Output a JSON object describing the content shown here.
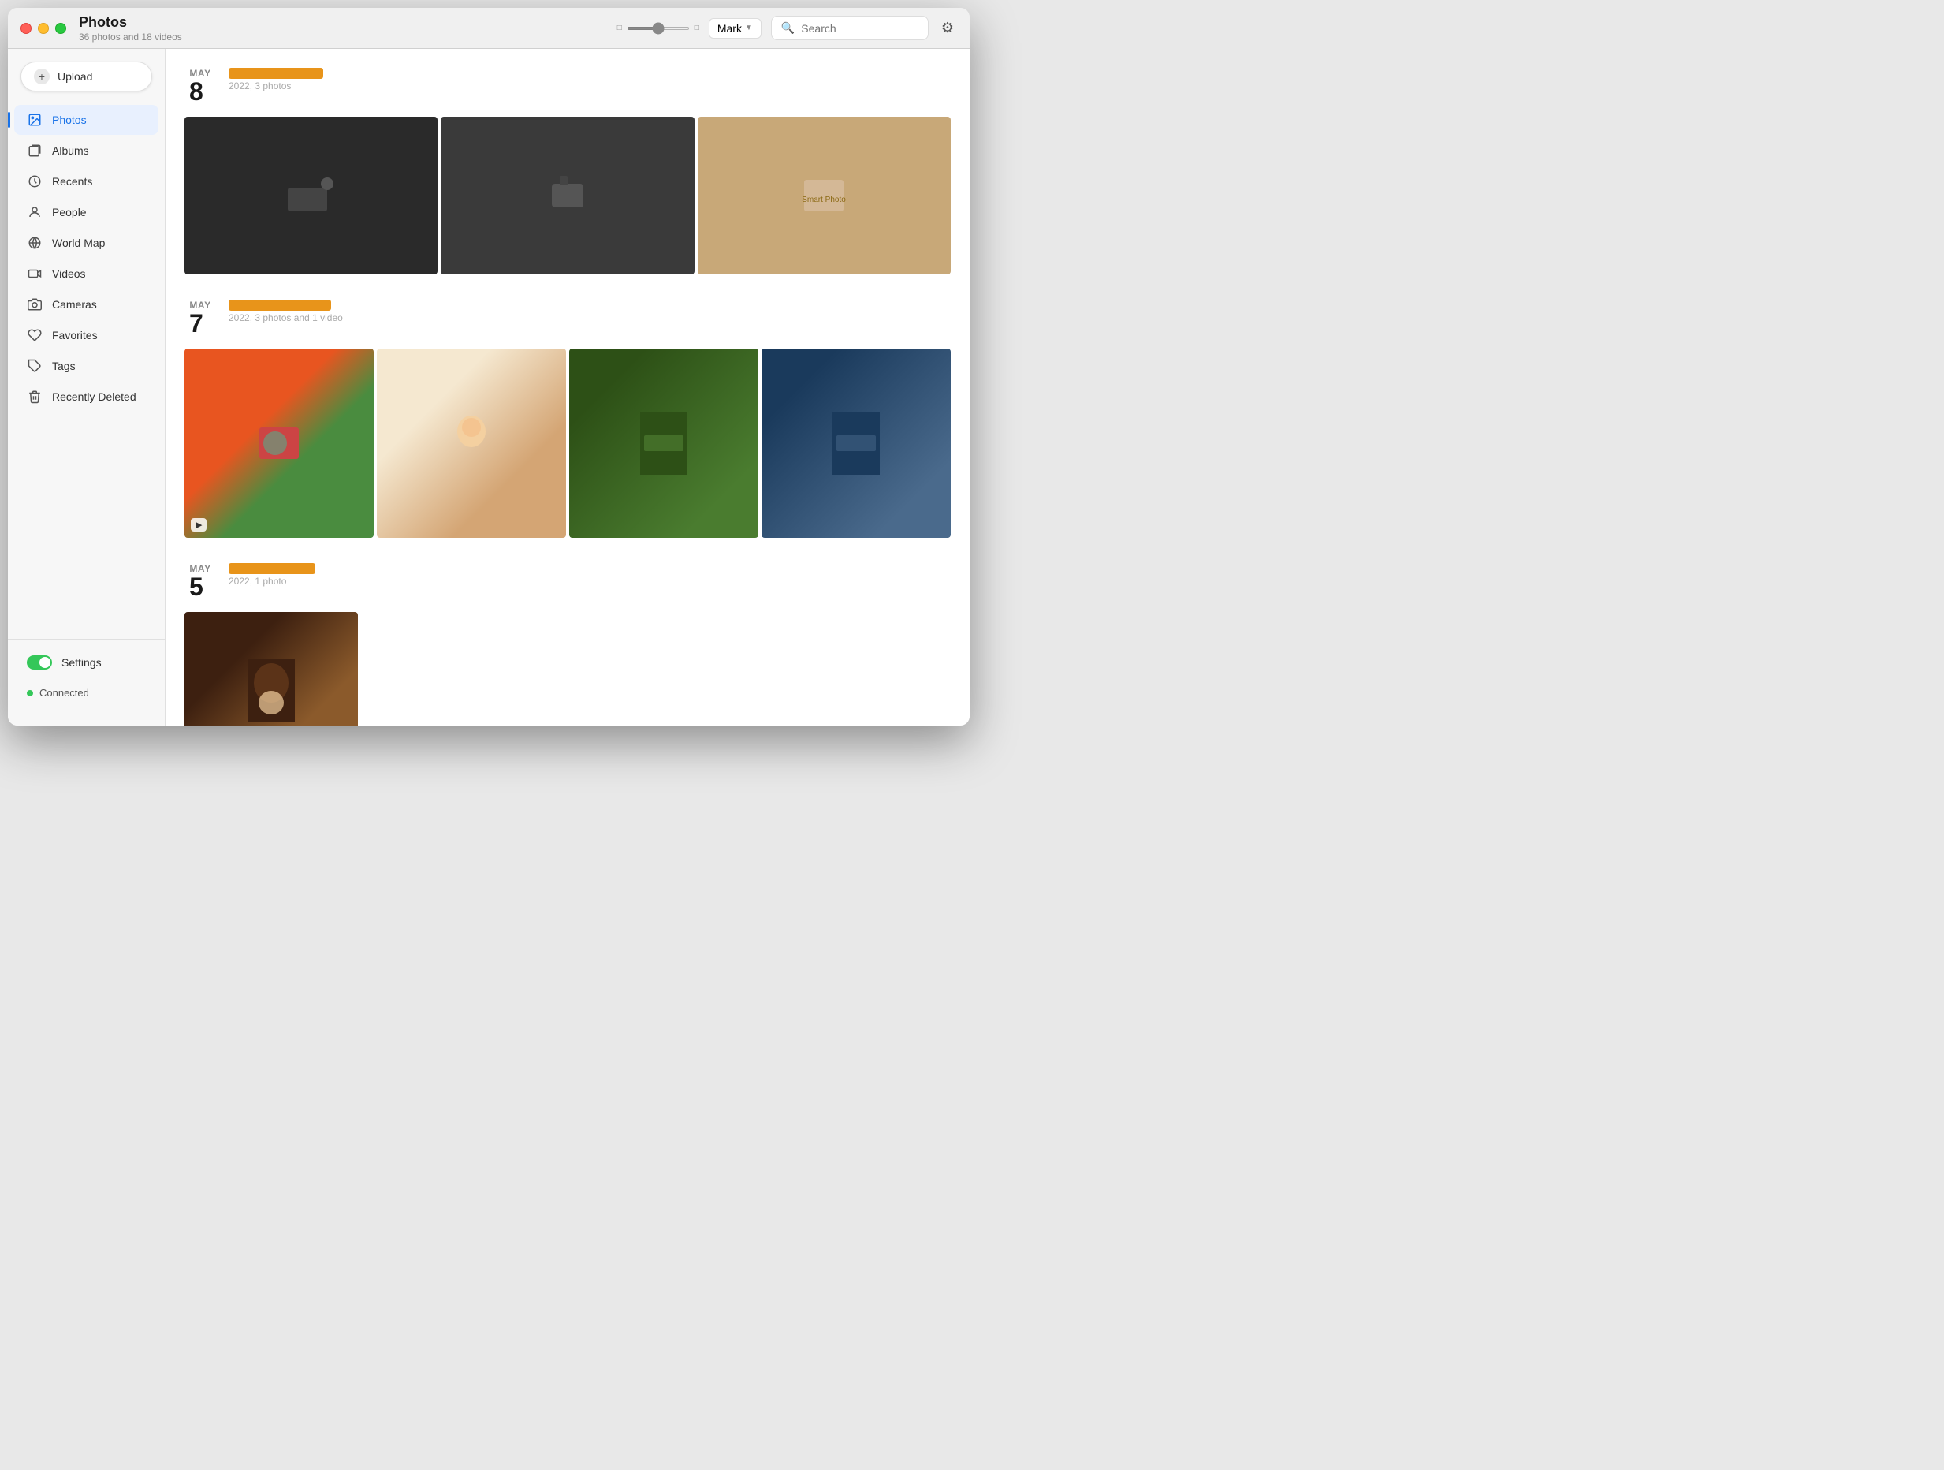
{
  "window": {
    "title": "Photos",
    "subtitle": "36 photos and 18 videos"
  },
  "header": {
    "user": "Mark",
    "search_placeholder": "Search",
    "slider_min_icon": "□",
    "slider_max_icon": "□"
  },
  "sidebar": {
    "upload_label": "Upload",
    "nav_items": [
      {
        "id": "photos",
        "label": "Photos",
        "icon": "photos",
        "active": true
      },
      {
        "id": "albums",
        "label": "Albums",
        "icon": "albums",
        "active": false
      },
      {
        "id": "recents",
        "label": "Recents",
        "icon": "recents",
        "active": false
      },
      {
        "id": "people",
        "label": "People",
        "icon": "people",
        "active": false
      },
      {
        "id": "worldmap",
        "label": "World Map",
        "icon": "worldmap",
        "active": false
      },
      {
        "id": "videos",
        "label": "Videos",
        "icon": "videos",
        "active": false
      },
      {
        "id": "cameras",
        "label": "Cameras",
        "icon": "cameras",
        "active": false
      },
      {
        "id": "favorites",
        "label": "Favorites",
        "icon": "favorites",
        "active": false
      },
      {
        "id": "tags",
        "label": "Tags",
        "icon": "tags",
        "active": false
      },
      {
        "id": "recently-deleted",
        "label": "Recently Deleted",
        "icon": "trash",
        "active": false
      }
    ],
    "settings_label": "Settings",
    "connected_label": "Connected"
  },
  "photo_groups": [
    {
      "id": "group1",
      "month": "MAY",
      "day": "8",
      "meta": "2022, 3 photos",
      "redacted_width": 120,
      "grid_class": "grid-3",
      "photos": [
        {
          "id": "p1",
          "color_class": "photo-dark",
          "has_video": false
        },
        {
          "id": "p2",
          "color_class": "photo-darkgray",
          "has_video": false
        },
        {
          "id": "p3",
          "color_class": "photo-beige",
          "has_video": false
        }
      ]
    },
    {
      "id": "group2",
      "month": "MAY",
      "day": "7",
      "meta": "2022, 3 photos and 1 video",
      "redacted_width": 130,
      "grid_class": "grid-4",
      "photos": [
        {
          "id": "p4",
          "color_class": "photo-colorful",
          "has_video": true
        },
        {
          "id": "p5",
          "color_class": "photo-baby",
          "has_video": false
        },
        {
          "id": "p6",
          "color_class": "photo-restaurant1",
          "has_video": false
        },
        {
          "id": "p7",
          "color_class": "photo-restaurant2",
          "has_video": false
        }
      ]
    },
    {
      "id": "group3",
      "month": "MAY",
      "day": "5",
      "meta": "2022, 1 photo",
      "redacted_width": 110,
      "grid_class": "grid-1",
      "photos": [
        {
          "id": "p8",
          "color_class": "photo-curly",
          "has_video": false
        }
      ]
    }
  ],
  "colors": {
    "accent": "#1a73e8",
    "active_bg": "#e8f0fe",
    "connected_green": "#34c759"
  }
}
